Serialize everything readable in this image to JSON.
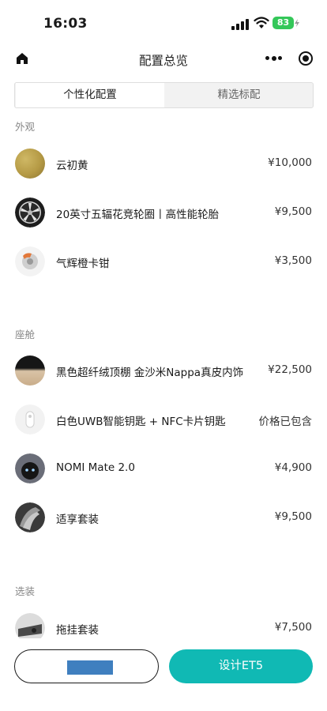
{
  "status_bar": {
    "time": "16:03",
    "battery": "83"
  },
  "nav": {
    "title": "配置总览"
  },
  "tabs": [
    {
      "label": "个性化配置",
      "active": true
    },
    {
      "label": "精选标配",
      "active": false
    }
  ],
  "sections": {
    "exterior": {
      "label": "外观",
      "items": [
        {
          "name": "云初黄",
          "price": "¥10,000"
        },
        {
          "name": "20英寸五辐花竞轮圈丨高性能轮胎",
          "price": "¥9,500"
        },
        {
          "name": "气辉橙卡钳",
          "price": "¥3,500"
        }
      ]
    },
    "cabin": {
      "label": "座舱",
      "items": [
        {
          "name": "黑色超纤绒顶棚 金沙米Nappa真皮内饰",
          "price": "¥22,500"
        },
        {
          "name": "白色UWB智能钥匙 + NFC卡片钥匙",
          "price": "价格已包含"
        },
        {
          "name": "NOMI Mate 2.0",
          "price": "¥4,900"
        },
        {
          "name": "适享套装",
          "price": "¥9,500"
        }
      ]
    },
    "options": {
      "label": "选装",
      "items": [
        {
          "name": "拖挂套装",
          "price": "¥7,500"
        }
      ]
    }
  },
  "bottom_bar": {
    "primary_label": "设计ET5"
  },
  "colors": {
    "accent": "#10b9b4",
    "battery": "#34c759",
    "color_swatch": "#b59a45"
  }
}
